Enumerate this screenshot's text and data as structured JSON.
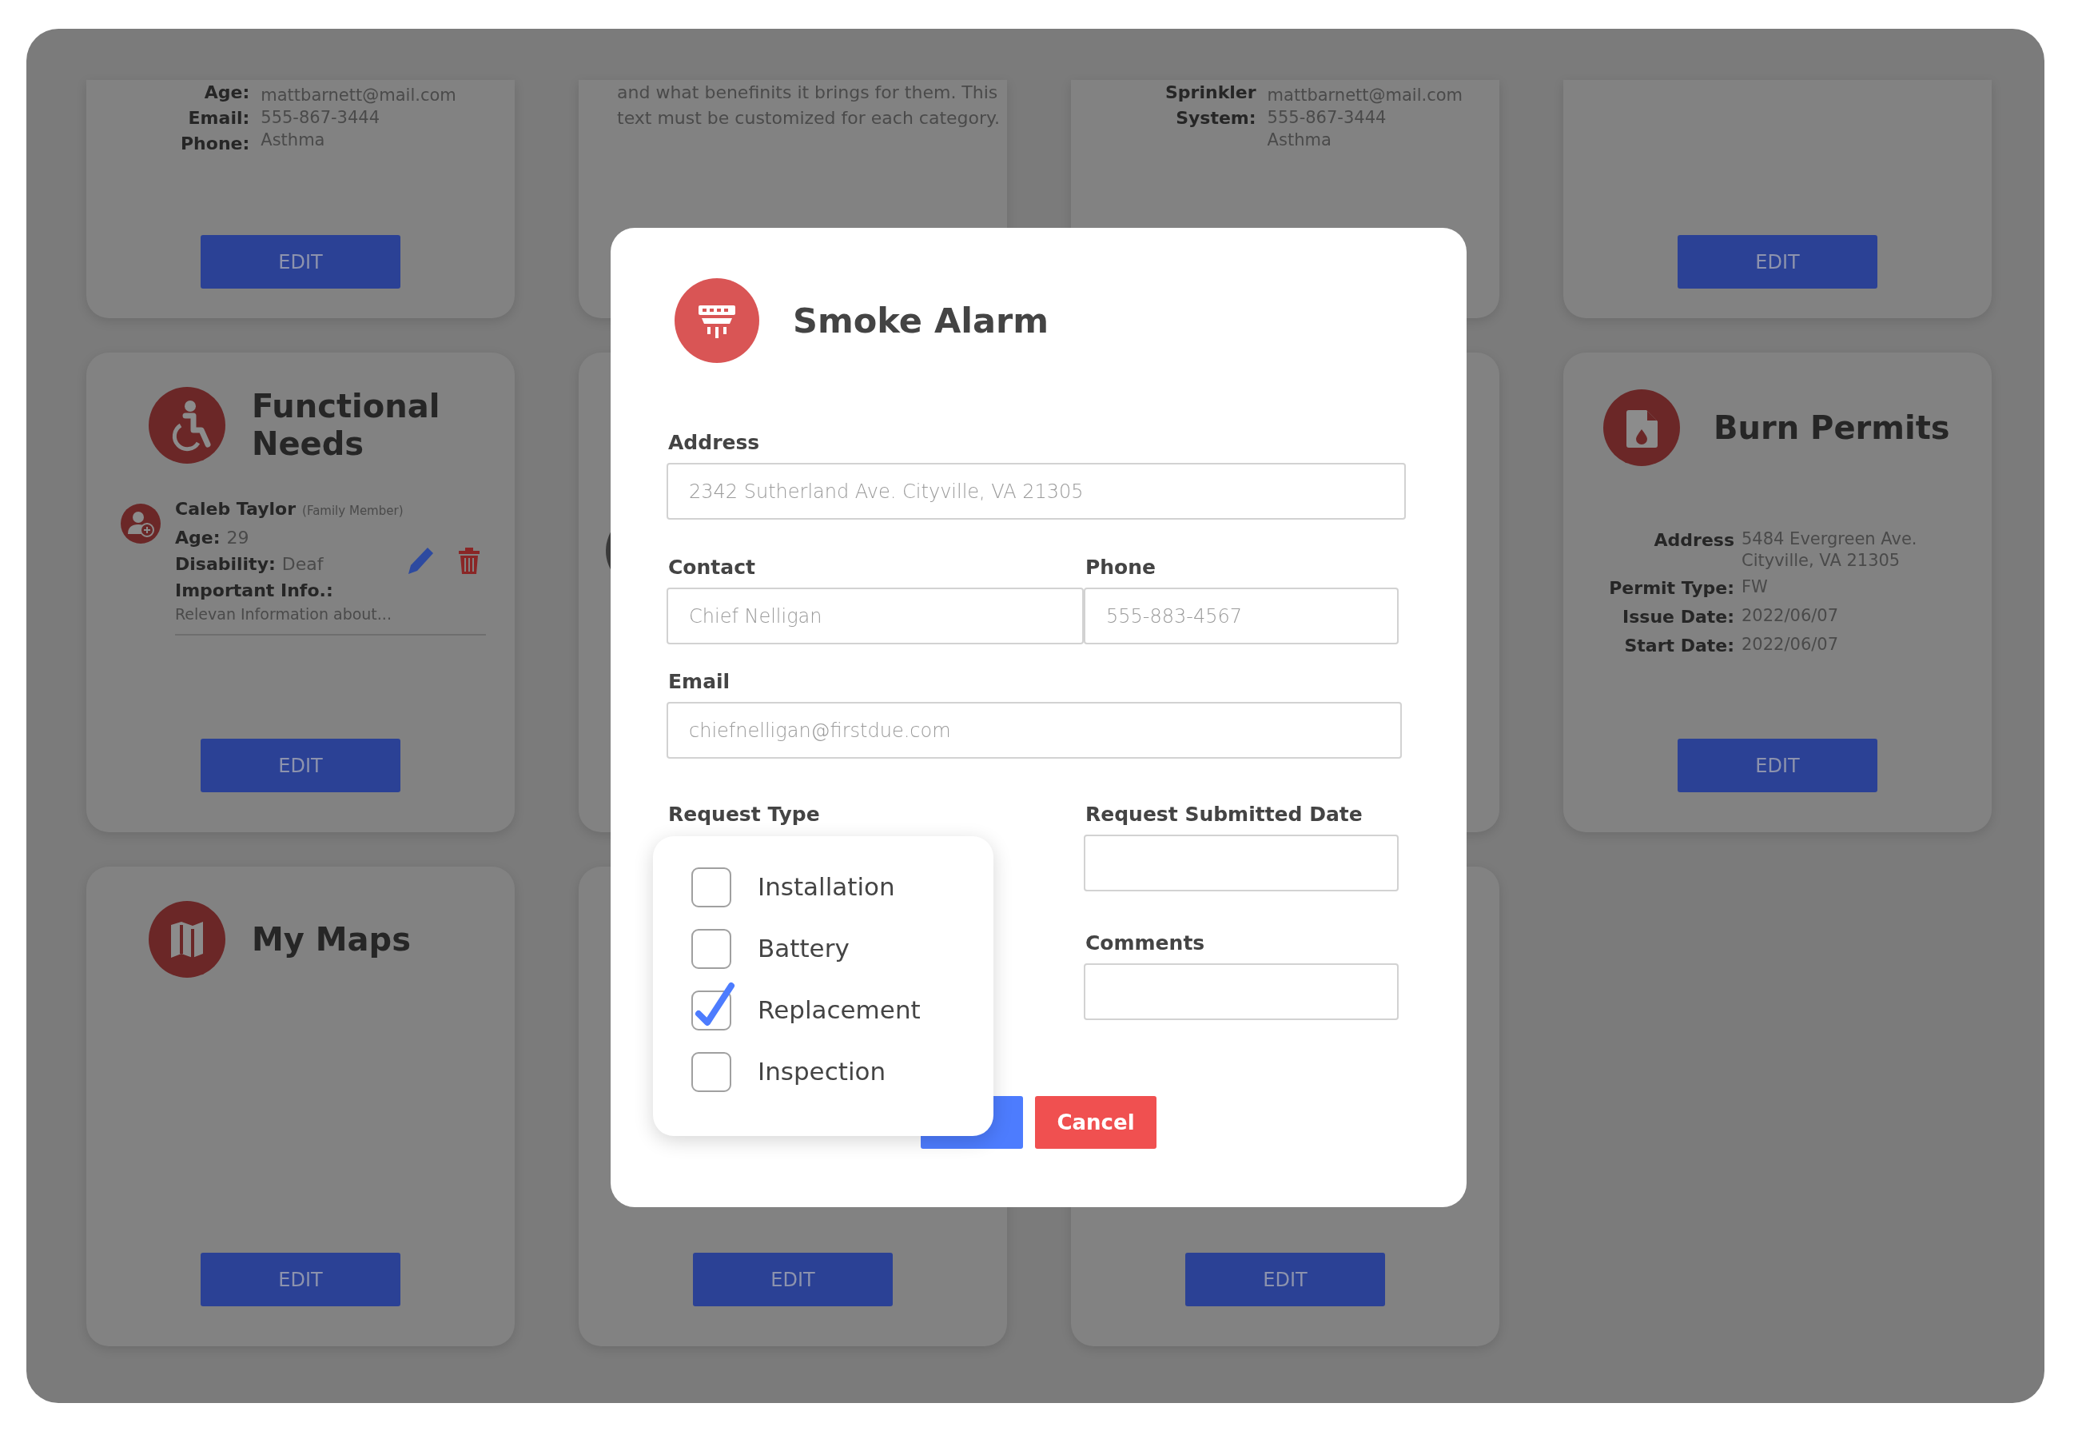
{
  "card_rows": [
    {
      "kind": "clipped",
      "cards": [
        {
          "kind": "contact",
          "labels": [
            "Age:",
            "Email:",
            "Phone:"
          ],
          "values": [
            "mattbarnett@mail.com",
            "555-867-3444",
            "Asthma"
          ],
          "button": "EDIT"
        },
        {
          "kind": "text",
          "text": "and what benefinits it brings for them. This text must be customized for each category."
        },
        {
          "kind": "contact",
          "labels": [
            "Sprinkler",
            "System:"
          ],
          "values": [
            "mattbarnett@mail.com",
            "555-867-3444",
            "Asthma"
          ]
        },
        {
          "kind": "blank",
          "button": "EDIT"
        }
      ]
    },
    {
      "kind": "full",
      "cards": [
        {
          "kind": "members",
          "title": "Functional Needs",
          "members": [
            {
              "name": "Caleb Taylor",
              "relation": "(Family Member)",
              "age_label": "Age:",
              "age": "29",
              "disability_label": "Disability:",
              "disability": "Deaf",
              "info_label": "Important Info.:",
              "info": "Relevan Information about..."
            }
          ],
          "button": "EDIT"
        },
        {
          "kind": "covered"
        },
        {
          "kind": "blank"
        },
        {
          "kind": "permit",
          "title": "Burn Permits",
          "fields": [
            {
              "label": "Address",
              "value": [
                "5484 Evergreen Ave.",
                "Cityville, VA 21305"
              ]
            },
            {
              "label": "Permit Type:",
              "value": [
                "FW"
              ]
            },
            {
              "label": "Issue Date:",
              "value": [
                "2022/06/07"
              ]
            },
            {
              "label": "Start Date:",
              "value": [
                "2022/06/07"
              ]
            }
          ],
          "button": "EDIT"
        }
      ]
    },
    {
      "kind": "full",
      "cards": [
        {
          "kind": "map",
          "title": "My Maps",
          "button": "EDIT"
        },
        {
          "kind": "blank",
          "button": "EDIT"
        },
        {
          "kind": "blank",
          "button": "EDIT"
        }
      ]
    }
  ],
  "modal": {
    "title": "Smoke Alarm",
    "address": {
      "label": "Address",
      "placeholder": "2342 Sutherland Ave. Cityville, VA 21305"
    },
    "contact": {
      "label": "Contact",
      "placeholder": "Chief Nelligan"
    },
    "phone": {
      "label": "Phone",
      "placeholder": "555-883-4567"
    },
    "email": {
      "label": "Email",
      "placeholder": "chiefnelligan@firstdue.com"
    },
    "request_type": {
      "label": "Request Type",
      "options": [
        {
          "label": "Installation",
          "checked": false
        },
        {
          "label": "Battery",
          "checked": false
        },
        {
          "label": "Replacement",
          "checked": true
        },
        {
          "label": "Inspection",
          "checked": false
        }
      ]
    },
    "submitted_date": {
      "label": "Request Submitted Date"
    },
    "comments": {
      "label": "Comments"
    },
    "buttons": [
      {
        "kind": "primary"
      },
      {
        "kind": "danger",
        "label": "Cancel"
      }
    ]
  }
}
